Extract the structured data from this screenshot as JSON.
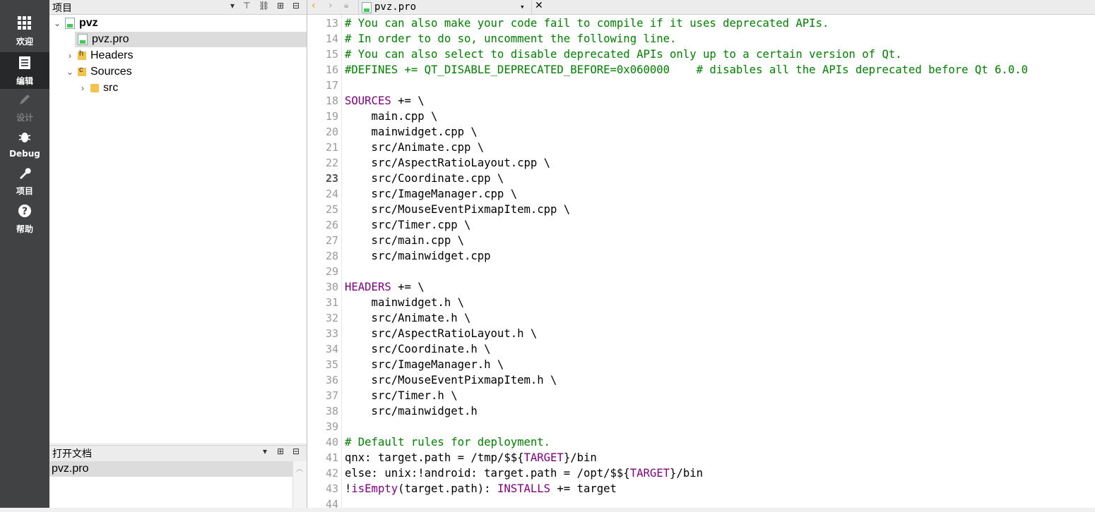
{
  "modes": [
    {
      "label": "欢迎",
      "icon": "grid-icon",
      "active": false,
      "disabled": false
    },
    {
      "label": "编辑",
      "icon": "document-icon",
      "active": true,
      "disabled": false
    },
    {
      "label": "设计",
      "icon": "pencil-icon",
      "active": false,
      "disabled": true
    },
    {
      "label": "Debug",
      "icon": "bug-icon",
      "active": false,
      "disabled": false
    },
    {
      "label": "项目",
      "icon": "wrench-icon",
      "active": false,
      "disabled": false
    },
    {
      "label": "帮助",
      "icon": "help-icon",
      "active": false,
      "disabled": false
    }
  ],
  "project_panel": {
    "title": "项目",
    "tree": [
      {
        "label": "pvz",
        "depth": 0,
        "expanded": true,
        "icon": "project-icon",
        "bold": true
      },
      {
        "label": "pvz.pro",
        "depth": 1,
        "icon": "pro-file-icon",
        "selected": true
      },
      {
        "label": "Headers",
        "depth": 1,
        "expanded": false,
        "icon": "headers-folder-icon"
      },
      {
        "label": "Sources",
        "depth": 1,
        "expanded": true,
        "icon": "sources-folder-icon"
      },
      {
        "label": "src",
        "depth": 2,
        "expanded": false,
        "icon": "folder-icon"
      }
    ]
  },
  "open_docs": {
    "title": "打开文档",
    "items": [
      "pvz.pro"
    ]
  },
  "editor": {
    "file_name": "pvz.pro",
    "current_line": 23,
    "lines": [
      {
        "n": "13",
        "segs": [
          {
            "t": "# You can also make your code fail to compile if it uses deprecated APIs.",
            "c": "cm"
          }
        ]
      },
      {
        "n": "14",
        "segs": [
          {
            "t": "# In order to do so, uncomment the following line.",
            "c": "cm"
          }
        ]
      },
      {
        "n": "15",
        "segs": [
          {
            "t": "# You can also select to disable deprecated APIs only up to a certain version of Qt.",
            "c": "cm"
          }
        ]
      },
      {
        "n": "16",
        "segs": [
          {
            "t": "#DEFINES += QT_DISABLE_DEPRECATED_BEFORE=0x060000    # disables all the APIs deprecated before Qt 6.0.0",
            "c": "cm"
          }
        ]
      },
      {
        "n": "17",
        "segs": []
      },
      {
        "n": "18",
        "segs": [
          {
            "t": "SOURCES",
            "c": "kw"
          },
          {
            "t": " += \\",
            "c": ""
          }
        ]
      },
      {
        "n": "19",
        "segs": [
          {
            "t": "    main.cpp \\",
            "c": ""
          }
        ]
      },
      {
        "n": "20",
        "segs": [
          {
            "t": "    mainwidget.cpp \\",
            "c": ""
          }
        ]
      },
      {
        "n": "21",
        "segs": [
          {
            "t": "    src/Animate.cpp \\",
            "c": ""
          }
        ]
      },
      {
        "n": "22",
        "segs": [
          {
            "t": "    src/AspectRatioLayout.cpp \\",
            "c": ""
          }
        ]
      },
      {
        "n": "23",
        "segs": [
          {
            "t": "    src/Coordinate.cpp \\",
            "c": ""
          }
        ]
      },
      {
        "n": "24",
        "segs": [
          {
            "t": "    src/ImageManager.cpp \\",
            "c": ""
          }
        ]
      },
      {
        "n": "25",
        "segs": [
          {
            "t": "    src/MouseEventPixmapItem.cpp \\",
            "c": ""
          }
        ]
      },
      {
        "n": "26",
        "segs": [
          {
            "t": "    src/Timer.cpp \\",
            "c": ""
          }
        ]
      },
      {
        "n": "27",
        "segs": [
          {
            "t": "    src/main.cpp \\",
            "c": ""
          }
        ]
      },
      {
        "n": "28",
        "segs": [
          {
            "t": "    src/mainwidget.cpp",
            "c": ""
          }
        ]
      },
      {
        "n": "29",
        "segs": []
      },
      {
        "n": "30",
        "segs": [
          {
            "t": "HEADERS",
            "c": "kw"
          },
          {
            "t": " += \\",
            "c": ""
          }
        ]
      },
      {
        "n": "31",
        "segs": [
          {
            "t": "    mainwidget.h \\",
            "c": ""
          }
        ]
      },
      {
        "n": "32",
        "segs": [
          {
            "t": "    src/Animate.h \\",
            "c": ""
          }
        ]
      },
      {
        "n": "33",
        "segs": [
          {
            "t": "    src/AspectRatioLayout.h \\",
            "c": ""
          }
        ]
      },
      {
        "n": "34",
        "segs": [
          {
            "t": "    src/Coordinate.h \\",
            "c": ""
          }
        ]
      },
      {
        "n": "35",
        "segs": [
          {
            "t": "    src/ImageManager.h \\",
            "c": ""
          }
        ]
      },
      {
        "n": "36",
        "segs": [
          {
            "t": "    src/MouseEventPixmapItem.h \\",
            "c": ""
          }
        ]
      },
      {
        "n": "37",
        "segs": [
          {
            "t": "    src/Timer.h \\",
            "c": ""
          }
        ]
      },
      {
        "n": "38",
        "segs": [
          {
            "t": "    src/mainwidget.h",
            "c": ""
          }
        ]
      },
      {
        "n": "39",
        "segs": []
      },
      {
        "n": "40",
        "segs": [
          {
            "t": "# Default rules for deployment.",
            "c": "cm"
          }
        ]
      },
      {
        "n": "41",
        "segs": [
          {
            "t": "qnx: target.path = /tmp/$${",
            "c": ""
          },
          {
            "t": "TARGET",
            "c": "kw"
          },
          {
            "t": "}/bin",
            "c": ""
          }
        ]
      },
      {
        "n": "42",
        "segs": [
          {
            "t": "else: unix:!android: target.path = /opt/$${",
            "c": ""
          },
          {
            "t": "TARGET",
            "c": "kw"
          },
          {
            "t": "}/bin",
            "c": ""
          }
        ]
      },
      {
        "n": "43",
        "segs": [
          {
            "t": "!",
            "c": ""
          },
          {
            "t": "isEmpty",
            "c": "kw"
          },
          {
            "t": "(target.path): ",
            "c": ""
          },
          {
            "t": "INSTALLS",
            "c": "kw"
          },
          {
            "t": " += target",
            "c": ""
          }
        ]
      },
      {
        "n": "44",
        "segs": []
      }
    ]
  },
  "colors": {
    "comment": "#008000",
    "keyword": "#800080",
    "modebar": "#404244"
  }
}
